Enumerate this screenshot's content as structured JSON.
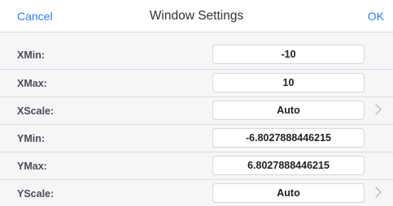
{
  "header": {
    "cancel_label": "Cancel",
    "title": "Window Settings",
    "ok_label": "OK"
  },
  "rows": [
    {
      "label": "XMin:",
      "value": "-10"
    },
    {
      "label": "XMax:",
      "value": "10"
    },
    {
      "label": "XScale:",
      "value": "Auto",
      "chevron": "chevron-right-icon"
    },
    {
      "label": "YMin:",
      "value": "-6.8027888446215"
    },
    {
      "label": "YMax:",
      "value": "6.8027888446215"
    },
    {
      "label": "YScale:",
      "value": "Auto",
      "chevron": "chevron-right-icon"
    }
  ],
  "colors": {
    "accent": "#2f7cf6",
    "background": "#f6f6f8"
  }
}
